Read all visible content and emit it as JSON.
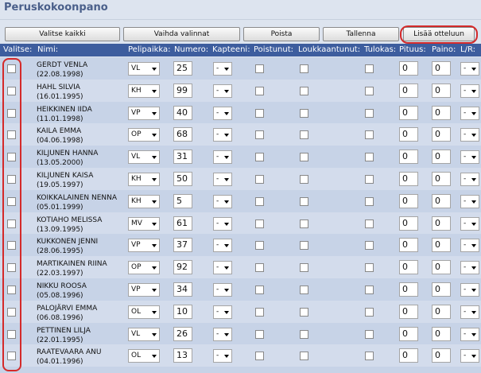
{
  "page": {
    "title": "Peruskokoonpano"
  },
  "toolbar": {
    "select_all": "Valitse kaikki",
    "invert": "Vaihda valinnat",
    "delete": "Poista",
    "save": "Tallenna",
    "add_to_match": "Lisää otteluun"
  },
  "columns": {
    "select": "Valitse:",
    "name": "Nimi:",
    "position": "Pelipaikka:",
    "number": "Numero:",
    "captain": "Kapteeni:",
    "left": "Poistunut:",
    "injured": "Loukkaantunut:",
    "result": "Tulokas:",
    "height": "Pituus:",
    "weight": "Paino:",
    "lr": "L/R:"
  },
  "players": [
    {
      "name": "GERDT VENLA",
      "dob": "(22.08.1998)",
      "position": "VL",
      "number": "25",
      "captain": "-",
      "height": "0",
      "weight": "0",
      "lr": "-"
    },
    {
      "name": "HAHL SILVIA",
      "dob": "(16.01.1995)",
      "position": "KH",
      "number": "99",
      "captain": "-",
      "height": "0",
      "weight": "0",
      "lr": "-"
    },
    {
      "name": "HEIKKINEN IIDA",
      "dob": "(11.01.1998)",
      "position": "VP",
      "number": "40",
      "captain": "-",
      "height": "0",
      "weight": "0",
      "lr": "-"
    },
    {
      "name": "KAILA EMMA",
      "dob": "(04.06.1998)",
      "position": "OP",
      "number": "68",
      "captain": "-",
      "height": "0",
      "weight": "0",
      "lr": "-"
    },
    {
      "name": "KILJUNEN HANNA",
      "dob": "(13.05.2000)",
      "position": "VL",
      "number": "31",
      "captain": "-",
      "height": "0",
      "weight": "0",
      "lr": "-"
    },
    {
      "name": "KILJUNEN KAISA",
      "dob": "(19.05.1997)",
      "position": "KH",
      "number": "50",
      "captain": "-",
      "height": "0",
      "weight": "0",
      "lr": "-"
    },
    {
      "name": "KOIKKALAINEN NENNA",
      "dob": "(05.01.1999)",
      "position": "KH",
      "number": "5",
      "captain": "-",
      "height": "0",
      "weight": "0",
      "lr": "-"
    },
    {
      "name": "KOTIAHO MELISSA",
      "dob": "(13.09.1995)",
      "position": "MV",
      "number": "61",
      "captain": "-",
      "height": "0",
      "weight": "0",
      "lr": "-"
    },
    {
      "name": "KUKKONEN JENNI",
      "dob": "(28.06.1995)",
      "position": "VP",
      "number": "37",
      "captain": "-",
      "height": "0",
      "weight": "0",
      "lr": "-"
    },
    {
      "name": "MARTIKAINEN RIINA",
      "dob": "(22.03.1997)",
      "position": "OP",
      "number": "92",
      "captain": "-",
      "height": "0",
      "weight": "0",
      "lr": "-"
    },
    {
      "name": "NIKKU ROOSA",
      "dob": "(05.08.1996)",
      "position": "VP",
      "number": "34",
      "captain": "-",
      "height": "0",
      "weight": "0",
      "lr": "-"
    },
    {
      "name": "PALOJÄRVI EMMA",
      "dob": "(06.08.1996)",
      "position": "OL",
      "number": "10",
      "captain": "-",
      "height": "0",
      "weight": "0",
      "lr": "-"
    },
    {
      "name": "PETTINEN LILJA",
      "dob": "(22.01.1995)",
      "position": "VL",
      "number": "26",
      "captain": "-",
      "height": "0",
      "weight": "0",
      "lr": "-"
    },
    {
      "name": "RAATEVAARA ANU",
      "dob": "(04.01.1996)",
      "position": "OL",
      "number": "13",
      "captain": "-",
      "height": "0",
      "weight": "0",
      "lr": "-"
    }
  ]
}
